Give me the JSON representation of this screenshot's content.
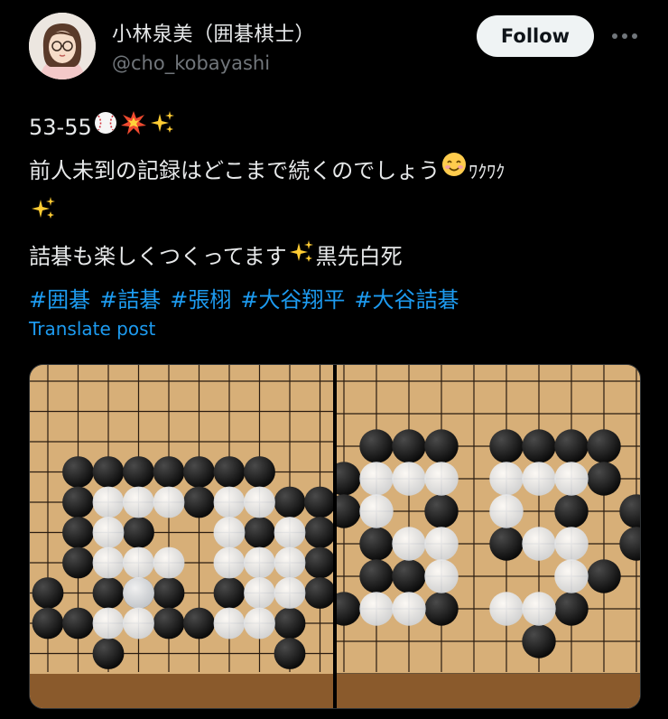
{
  "author": {
    "display_name": "小林泉美（囲碁棋士）",
    "handle": "@cho_kobayashi",
    "avatar_icon": "avatar-illustration"
  },
  "actions": {
    "follow_label": "Follow",
    "more_icon": "more-dots-icon"
  },
  "post": {
    "line1_text": "53-55",
    "line1_emojis": [
      "baseball-icon",
      "collision-icon",
      "sparkles-icon"
    ],
    "line2_text": "前人未到の記録はどこまで続くのでしょう",
    "line2_emoji": "smiling-face-icon",
    "line2_suffix": "ﾜｸﾜｸ",
    "line3_emoji": "sparkles-icon",
    "line4_text": "詰碁も楽しくつくってます",
    "line4_emoji": "sparkles-icon",
    "line4_suffix": "黒先白死",
    "hashtags": [
      "#囲碁",
      "#詰碁",
      "#張栩",
      "#大谷翔平",
      "#大谷詰碁"
    ],
    "translate_label": "Translate post"
  },
  "media": {
    "images": [
      "go-board-photo-left",
      "go-board-photo-right"
    ]
  },
  "colors": {
    "background": "#000000",
    "text": "#e7e9ea",
    "secondary": "#71767b",
    "link": "#1d9bf0",
    "follow_bg": "#eff3f4",
    "board": "#d9b27a",
    "black_stone": "#0b0b0b",
    "white_stone": "#f1f1f1"
  }
}
